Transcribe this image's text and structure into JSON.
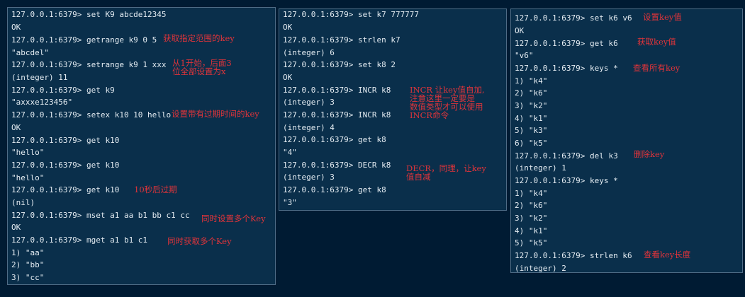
{
  "terminals": [
    {
      "lines": [
        "127.0.0.1:6379> set K9 abcde12345",
        "OK",
        "127.0.0.1:6379> getrange k9 0 5",
        "\"abcdel\"",
        "127.0.0.1:6379> setrange k9 1 xxx",
        "(integer) 11",
        "127.0.0.1:6379> get k9",
        "\"axxxe123456\"",
        "127.0.0.1:6379> setex k10 10 hello",
        "OK",
        "127.0.0.1:6379> get k10",
        "\"hello\"",
        "127.0.0.1:6379> get k10",
        "\"hello\"",
        "127.0.0.1:6379> get k10",
        "(nil)",
        "127.0.0.1:6379> mset a1 aa b1 bb c1 cc",
        "OK",
        "127.0.0.1:6379> mget a1 b1 c1",
        "1) \"aa\"",
        "2) \"bb\"",
        "3) \"cc\""
      ],
      "notes": [
        "获取指定范围的key",
        "从1开始，后面3\n位全部设置为x",
        "设置带有过期时间的key",
        "10秒后过期",
        "同时设置多个Key",
        "同时获取多个Key"
      ]
    },
    {
      "lines": [
        "127.0.0.1:6379> set k7 777777",
        "OK",
        "127.0.0.1:6379> strlen k7",
        "(integer) 6",
        "127.0.0.1:6379> set k8 2",
        "OK",
        "127.0.0.1:6379> INCR k8",
        "(integer) 3",
        "127.0.0.1:6379> INCR k8",
        "(integer) 4",
        "127.0.0.1:6379> get k8",
        "\"4\"",
        "127.0.0.1:6379> DECR k8",
        "(integer) 3",
        "127.0.0.1:6379> get k8",
        "\"3\""
      ],
      "notes": [
        "INCR 让key值自加,\n注意这里一定要是\n数值类型才可以使用\nINCR命令",
        "DECR，同理，让key\n值自减"
      ]
    },
    {
      "lines": [
        "127.0.0.1:6379> set k6 v6",
        "OK",
        "127.0.0.1:6379> get k6",
        "\"v6\"",
        "127.0.0.1:6379> keys *",
        "1) \"k4\"",
        "2) \"k6\"",
        "3) \"k2\"",
        "4) \"k1\"",
        "5) \"k3\"",
        "6) \"k5\"",
        "127.0.0.1:6379> del k3",
        "(integer) 1",
        "127.0.0.1:6379> keys *",
        "1) \"k4\"",
        "2) \"k6\"",
        "3) \"k2\"",
        "4) \"k1\"",
        "5) \"k5\"",
        "127.0.0.1:6379> strlen k6",
        "(integer) 2"
      ],
      "notes": [
        "设置key值",
        "获取key值",
        "查看所有key",
        "删除key",
        "查看key长度"
      ]
    }
  ]
}
